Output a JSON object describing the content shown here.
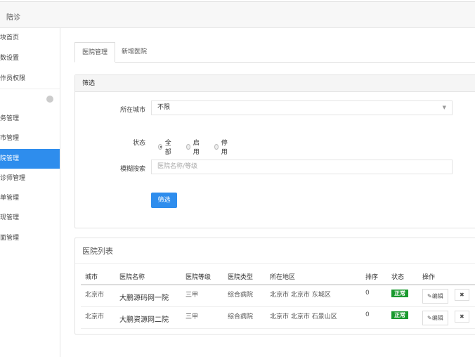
{
  "header": {
    "title": "陪诊"
  },
  "sidebar": {
    "items": [
      {
        "label": "块首页"
      },
      {
        "label": "数设置"
      },
      {
        "label": "作员权限"
      },
      {
        "label": "务管理"
      },
      {
        "label": "市管理"
      },
      {
        "label": "院管理",
        "active": true
      },
      {
        "label": "诊师管理"
      },
      {
        "label": "单管理"
      },
      {
        "label": "现管理"
      },
      {
        "label": "面管理"
      }
    ]
  },
  "tabs": [
    {
      "label": "医院管理"
    },
    {
      "label": "新增医院"
    }
  ],
  "filter": {
    "title": "筛选",
    "city_label": "所在城市",
    "city_value": "不限",
    "status_label": "状态",
    "status_options": [
      {
        "label": "全部",
        "checked": true
      },
      {
        "label": "启用"
      },
      {
        "label": "停用"
      }
    ],
    "search_label": "模糊搜索",
    "search_placeholder": "医院名称/等级",
    "submit": "筛选"
  },
  "list": {
    "title": "医院列表",
    "columns": [
      "城市",
      "医院名称",
      "医院等级",
      "医院类型",
      "所在地区",
      "排序",
      "状态",
      "操作"
    ],
    "rows": [
      {
        "city": "北京市",
        "name": "大鹏源码网一院",
        "level": "三甲",
        "type": "综合病院",
        "region": "北京市 北京市 东城区",
        "sort": "0",
        "status": "正常",
        "edit": "✎编辑",
        "del": "✖"
      },
      {
        "city": "北京市",
        "name": "大鹏资源网二院",
        "level": "三甲",
        "type": "综合病院",
        "region": "北京市 北京市 石景山区",
        "sort": "0",
        "status": "正常",
        "edit": "✎编辑",
        "del": "✖"
      }
    ]
  },
  "colors": {
    "accent": "#2e8ded",
    "status_ok": "#1a9a2f"
  }
}
